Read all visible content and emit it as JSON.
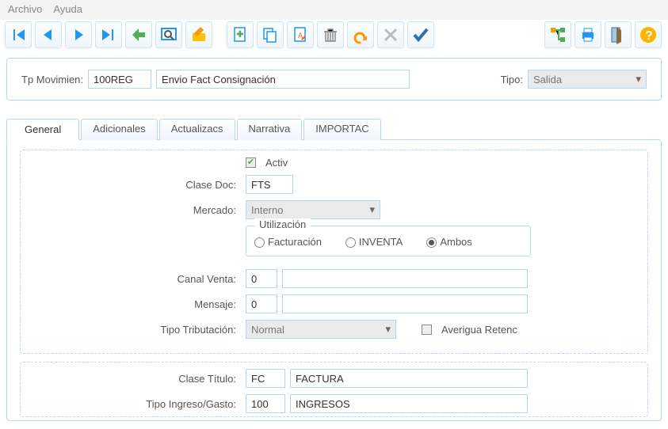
{
  "menu": {
    "archivo": "Archivo",
    "ayuda": "Ayuda"
  },
  "header": {
    "tp_movimien_label": "Tp Movimien:",
    "tp_movimien_value": "100REG",
    "tp_movimien_desc": "Envio Fact Consignación",
    "tipo_label": "Tipo:",
    "tipo_value": "Salida"
  },
  "tabs": {
    "general": "General",
    "adicionales": "Adicionales",
    "actualizacs": "Actualizacs",
    "narrativa": "Narrativa",
    "importac": "IMPORTAC"
  },
  "form": {
    "activ_label": "Activ",
    "clase_doc_label": "Clase Doc:",
    "clase_doc_value": "FTS",
    "mercado_label": "Mercado:",
    "mercado_value": "Interno",
    "utilizacion_title": "Utilización",
    "facturacion": "Facturación",
    "inventa": "INVENTA",
    "ambos": "Ambos",
    "canal_venta_label": "Canal Venta:",
    "canal_venta_value": "0",
    "mensaje_label": "Mensaje:",
    "mensaje_value": "0",
    "tipo_trib_label": "Tipo Tributación:",
    "tipo_trib_value": "Normal",
    "averigua_label": "Averigua Retenc",
    "clase_titulo_label": "Clase Título:",
    "clase_titulo_code": "FC",
    "clase_titulo_desc": "FACTURA",
    "tipo_ing_label": "Tipo Ingreso/Gasto:",
    "tipo_ing_code": "100",
    "tipo_ing_desc": "INGRESOS"
  }
}
